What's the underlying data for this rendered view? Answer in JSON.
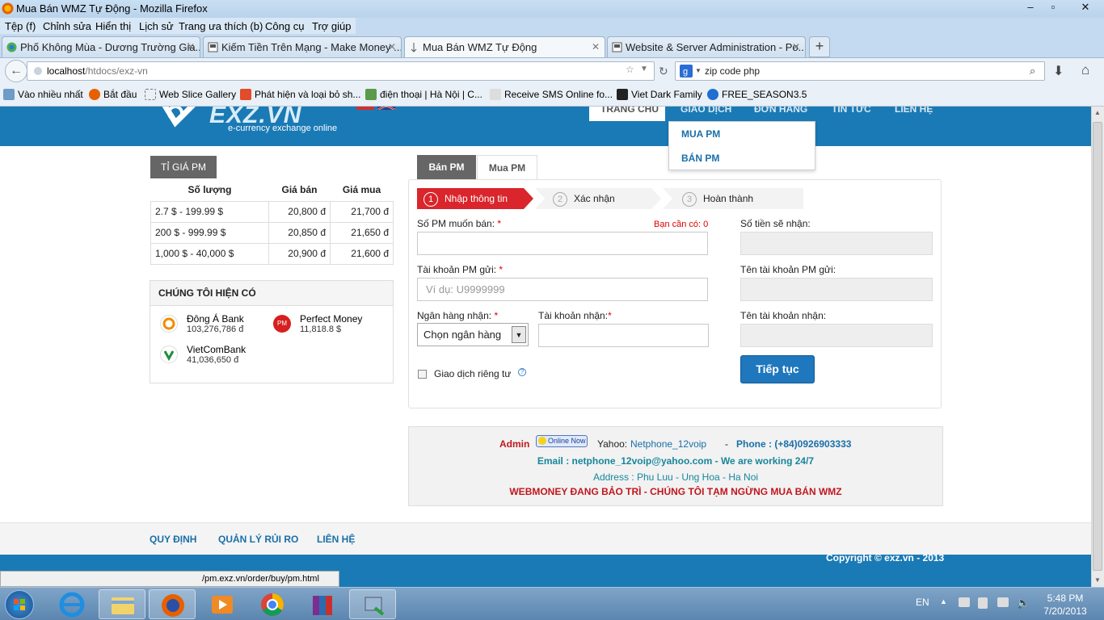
{
  "window": {
    "title": "Mua Bán WMZ Tự Động - Mozilla Firefox"
  },
  "menu": [
    "Tệp (f)",
    "Chỉnh sửa",
    "Hiển thị",
    "Lịch sử",
    "Trang ưa thích (b)",
    "Công cụ",
    "Trợ giúp"
  ],
  "tabs": [
    {
      "label": "Phố Không Mùa - Dương Trường Gia...",
      "active": false
    },
    {
      "label": "Kiếm Tiền Trên Mạng - Make Money ...",
      "active": false
    },
    {
      "label": "Mua Bán WMZ Tự Động",
      "active": true
    },
    {
      "label": "Website & Server Administration - Po...",
      "active": false
    }
  ],
  "address": {
    "host": "localhost",
    "path": "/htdocs/exz-vn"
  },
  "search": {
    "text": "zip code php"
  },
  "bookmarks": [
    "Vào nhiều nhất",
    "Bắt đầu",
    "Web Slice Gallery",
    "Phát hiện và loại bỏ sh...",
    "điện thoại | Hà Nội | C...",
    "Receive SMS Online fo...",
    "Viet Dark Family",
    "FREE_SEASON3.5"
  ],
  "site": {
    "logo_text": "EXZ.VN",
    "logo_sub": "e-currency exchange online",
    "nav": [
      "TRANG CHỦ",
      "GIAO DỊCH",
      "ĐƠN HÀNG",
      "TIN TỨC",
      "LIÊN HỆ"
    ],
    "dropdown": [
      "MUA PM",
      "BÁN PM"
    ]
  },
  "rates": {
    "tab": "TỈ GIÁ PM",
    "headers": [
      "Số lượng",
      "Giá bán",
      "Giá mua"
    ],
    "rows": [
      [
        "2.7 $ - 199.99 $",
        "20,800 đ",
        "21,700 đ"
      ],
      [
        "200 $ - 999.99 $",
        "20,850 đ",
        "21,650 đ"
      ],
      [
        "1,000 $ - 40,000 $",
        "20,900 đ",
        "21,600 đ"
      ]
    ]
  },
  "have": {
    "title": "CHÚNG TÔI HIỆN CÓ",
    "banks": [
      {
        "name": "Đông Á Bank",
        "amount": "103,276,786 đ"
      },
      {
        "name": "Perfect Money",
        "amount": "11,818.8 $"
      },
      {
        "name": "VietComBank",
        "amount": "41,036,650 đ"
      }
    ]
  },
  "form": {
    "tab_sell": "Bán PM",
    "tab_buy": "Mua PM",
    "steps": [
      {
        "num": "1",
        "label": "Nhập thông tin"
      },
      {
        "num": "2",
        "label": "Xác nhận"
      },
      {
        "num": "3",
        "label": "Hoàn thành"
      }
    ],
    "amount_label": "Số PM muốn bán:",
    "need_label": "Bạn cần có: 0",
    "receive_label": "Số tiền sẽ nhận:",
    "account_label": "Tài khoản PM gửi:",
    "account_placeholder": "Ví dụ: U9999999",
    "account_name_label": "Tên tài khoản PM gửi:",
    "bank_label": "Ngân hàng nhận:",
    "bank_select": "Chọn ngân hàng",
    "bank_account_label": "Tài khoản nhận:",
    "bank_account_name_label": "Tên tài khoản nhận:",
    "private_label": "Giao dịch riêng tư",
    "submit": "Tiếp tục",
    "req": "*"
  },
  "contact": {
    "admin": "Admin",
    "online": "Online Now",
    "yahoo_label": "Yahoo:",
    "yahoo": "Netphone_12voip",
    "phone": "Phone : (+84)0926903333",
    "email": "Email : netphone_12voip@yahoo.com - We are working 24/7",
    "address": "Address : Phu Luu - Ung Hoa - Ha Noi",
    "notice": "WEBMONEY ĐANG BẢO TRÌ - CHÚNG TÔI TẠM NGỪNG MUA BÁN WMZ"
  },
  "footer": {
    "links": [
      "QUY ĐỊNH",
      "QUẢN LÝ RỦI RO",
      "LIÊN HỆ"
    ],
    "copyright": "Copyright © exz.vn - 2013"
  },
  "status_url": "/pm.exz.vn/order/buy/pm.html",
  "taskbar": {
    "lang": "EN",
    "time": "5:48 PM",
    "date": "7/20/2013"
  }
}
